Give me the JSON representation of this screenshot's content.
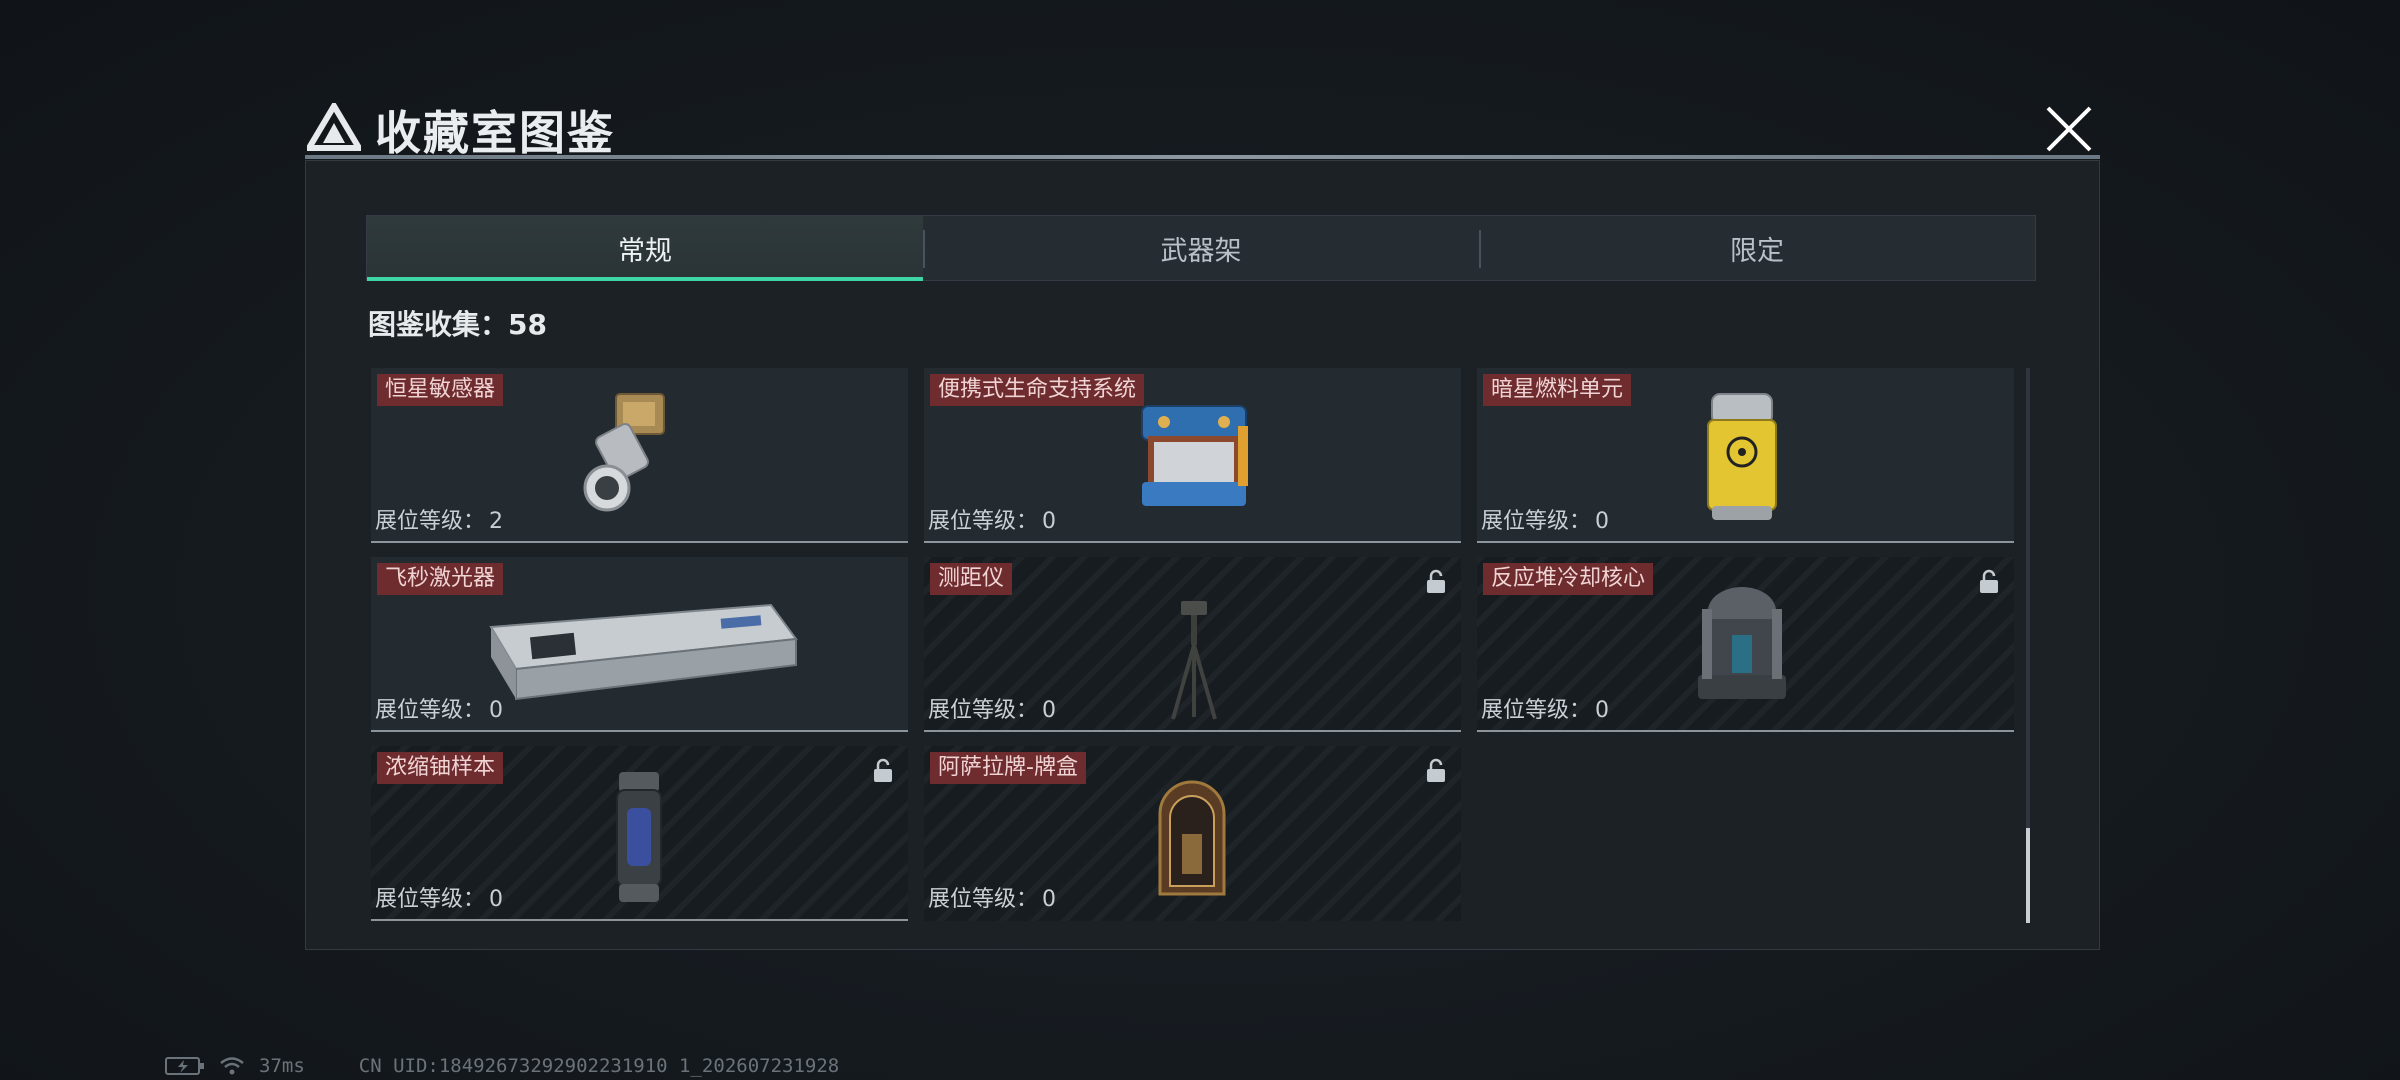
{
  "modal": {
    "title": "收藏室图鉴",
    "close_icon": "close-icon"
  },
  "tabs": [
    {
      "label": "常规",
      "active": true
    },
    {
      "label": "武器架",
      "active": false
    },
    {
      "label": "限定",
      "active": false
    }
  ],
  "collection": {
    "label": "图鉴收集：",
    "count": "58"
  },
  "items": [
    {
      "name": "恒星敏感器",
      "level_label": "展位等级：",
      "level": "2",
      "locked": false,
      "icon": "star-sensor-icon"
    },
    {
      "name": "便携式生命支持系统",
      "level_label": "展位等级：",
      "level": "0",
      "locked": false,
      "icon": "life-support-icon"
    },
    {
      "name": "暗星燃料单元",
      "level_label": "展位等级：",
      "level": "0",
      "locked": false,
      "icon": "fuel-cell-icon"
    },
    {
      "name": "飞秒激光器",
      "level_label": "展位等级：",
      "level": "0",
      "locked": false,
      "icon": "laser-icon"
    },
    {
      "name": "测距仪",
      "level_label": "展位等级：",
      "level": "0",
      "locked": true,
      "icon": "rangefinder-icon"
    },
    {
      "name": "反应堆冷却核心",
      "level_label": "展位等级：",
      "level": "0",
      "locked": true,
      "icon": "reactor-core-icon"
    },
    {
      "name": "浓缩铀样本",
      "level_label": "展位等级：",
      "level": "0",
      "locked": true,
      "icon": "uranium-sample-icon"
    },
    {
      "name": "阿萨拉牌-牌盒",
      "level_label": "展位等级：",
      "level": "0",
      "locked": true,
      "icon": "card-box-icon"
    }
  ],
  "status_bar": {
    "ping": "37ms",
    "uid": "CN UID:18492673292902231910 1_202607231928"
  },
  "colors": {
    "accent": "#3fd6a6",
    "label_bg": "#6e2c2f"
  }
}
